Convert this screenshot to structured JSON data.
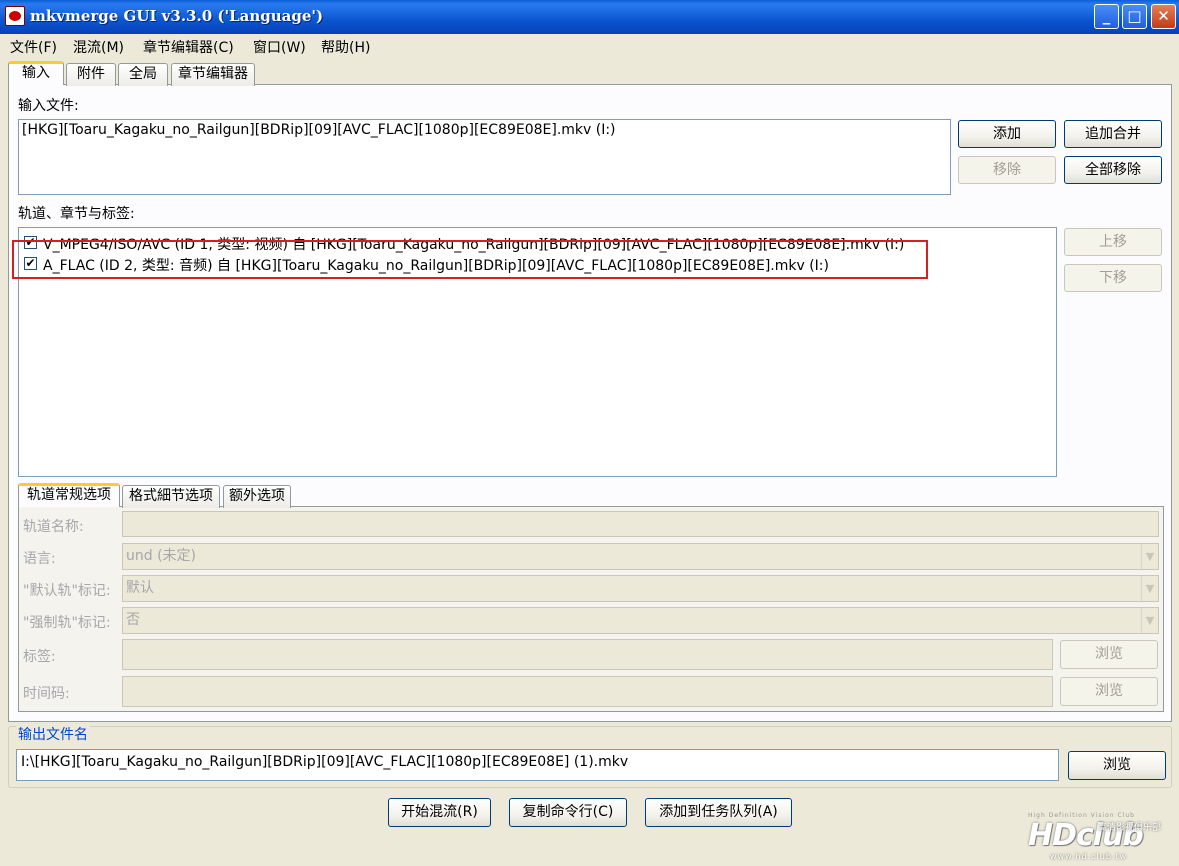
{
  "window": {
    "title": "mkvmerge GUI v3.3.0 ('Language')",
    "minimize_glyph": "_",
    "maximize_glyph": "□",
    "close_glyph": "✕"
  },
  "menu": [
    "文件(F)",
    "混流(M)",
    "章节编辑器(C)",
    "窗口(W)",
    "帮助(H)"
  ],
  "main_tabs": [
    "输入",
    "附件",
    "全局",
    "章节编辑器"
  ],
  "input": {
    "label": "输入文件:",
    "files": [
      "[HKG][Toaru_Kagaku_no_Railgun][BDRip][09][AVC_FLAC][1080p][EC89E08E].mkv (I:)"
    ],
    "buttons": {
      "add": "添加",
      "append": "追加合并",
      "remove": "移除",
      "remove_all": "全部移除"
    }
  },
  "tracks": {
    "label": "轨道、章节与标签:",
    "items": [
      {
        "checked": true,
        "check_glyph": "✔",
        "text": "V_MPEG4/ISO/AVC (ID 1, 类型: 视频) 自 [HKG][Toaru_Kagaku_no_Railgun][BDRip][09][AVC_FLAC][1080p][EC89E08E].mkv (I:)"
      },
      {
        "checked": true,
        "check_glyph": "✔",
        "text": "A_FLAC (ID 2, 类型: 音频) 自 [HKG][Toaru_Kagaku_no_Railgun][BDRip][09][AVC_FLAC][1080p][EC89E08E].mkv (I:)"
      }
    ],
    "buttons": {
      "up": "上移",
      "down": "下移"
    }
  },
  "sub_tabs": [
    "轨道常规选项",
    "格式細节选项",
    "额外选项"
  ],
  "track_options": {
    "name_label": "轨道名称:",
    "name_value": "",
    "language_label": "语言:",
    "language_value": "und (未定)",
    "default_label": "\"默认轨\"标记:",
    "default_value": "默认",
    "forced_label": "\"强制轨\"标记:",
    "forced_value": "否",
    "tags_label": "标签:",
    "tags_value": "",
    "timecodes_label": "时间码:",
    "timecodes_value": "",
    "browse": "浏览",
    "dropdown_glyph": "▼"
  },
  "output": {
    "legend": "输出文件名",
    "path": "I:\\[HKG][Toaru_Kagaku_no_Railgun][BDRip][09][AVC_FLAC][1080p][EC89E08E] (1).mkv",
    "browse": "浏览"
  },
  "actions": {
    "start": "开始混流(R)",
    "copy_cmd": "复制命令行(C)",
    "add_queue": "添加到任务队列(A)"
  },
  "watermark": {
    "tagline": "High Definition Vision Club",
    "logo": "HDclub",
    "site": "www.hd.club.tw",
    "chinese": "高清影视俱乐部"
  }
}
